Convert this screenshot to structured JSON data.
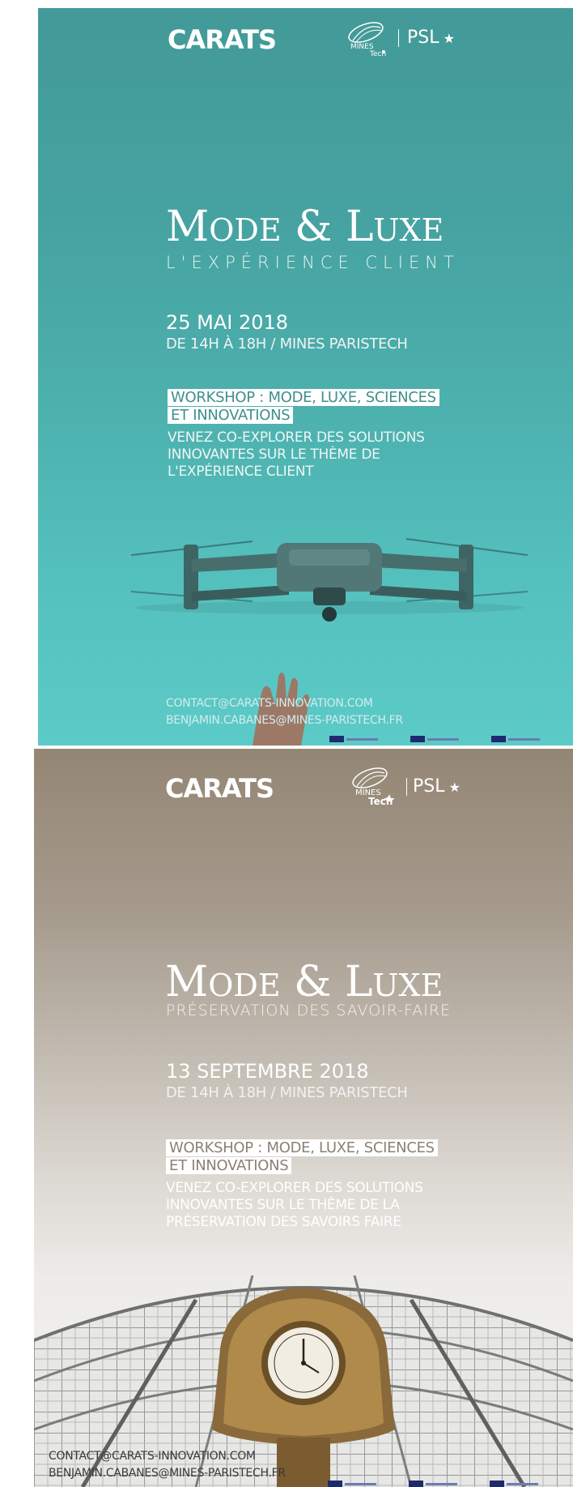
{
  "posters": [
    {
      "logo_carats": "CARATS",
      "logo_mines_top": "MINES",
      "logo_mines_bottom": "Tech",
      "logo_psl": "PSL",
      "title_line": "Mode & Luxe",
      "subtitle": "L'EXPÉRIENCE CLIENT",
      "date": "25 MAI 2018",
      "time": "DE 14H À  18H / MINES PARISTECH",
      "workshop_line1": "WORKSHOP : MODE, LUXE, SCIENCES",
      "workshop_line2": "ET INNOVATIONS",
      "desc_line1": "VENEZ CO-EXPLORER DES SOLUTIONS",
      "desc_line2": "INNOVANTES SUR LE THÈME DE",
      "desc_line3": "L'EXPÉRIENCE CLIENT",
      "contact_email": "CONTACT@CARATS-INNOVATION.COM",
      "contact_person": "BENJAMIN.CABANES@MINES-PARISTECH.FR",
      "image": "drone-photo",
      "background_color": "#46a3a1"
    },
    {
      "logo_carats": "CARATS",
      "logo_mines_top": "MINES",
      "logo_mines_bottom": "Tech",
      "logo_psl": "PSL",
      "title_line": "Mode & Luxe",
      "subtitle": "PRÉSERVATION DES SAVOIR-FAIRE",
      "date": "13 SEPTEMBRE 2018",
      "time": "DE 14H À  18H / MINES PARISTECH",
      "workshop_line1": "WORKSHOP : MODE, LUXE, SCIENCES",
      "workshop_line2": "ET INNOVATIONS",
      "desc_line1": "VENEZ CO-EXPLORER DES SOLUTIONS",
      "desc_line2": "INNOVANTES SUR LE THÈME DE LA",
      "desc_line3": "PRÉSERVATION DES SAVOIRS FAIRE",
      "contact_email": "CONTACT@CARATS-INNOVATION.COM",
      "contact_person": "BENJAMIN.CABANES@MINES-PARISTECH.FR",
      "image": "orsay-clock-photo",
      "background_color": "#948674"
    }
  ],
  "colors": {
    "teal": "#46a3a1",
    "taupe": "#948674",
    "workshop_text_teal": "#3f8f8d",
    "workshop_text_taupe": "#8a8176"
  }
}
